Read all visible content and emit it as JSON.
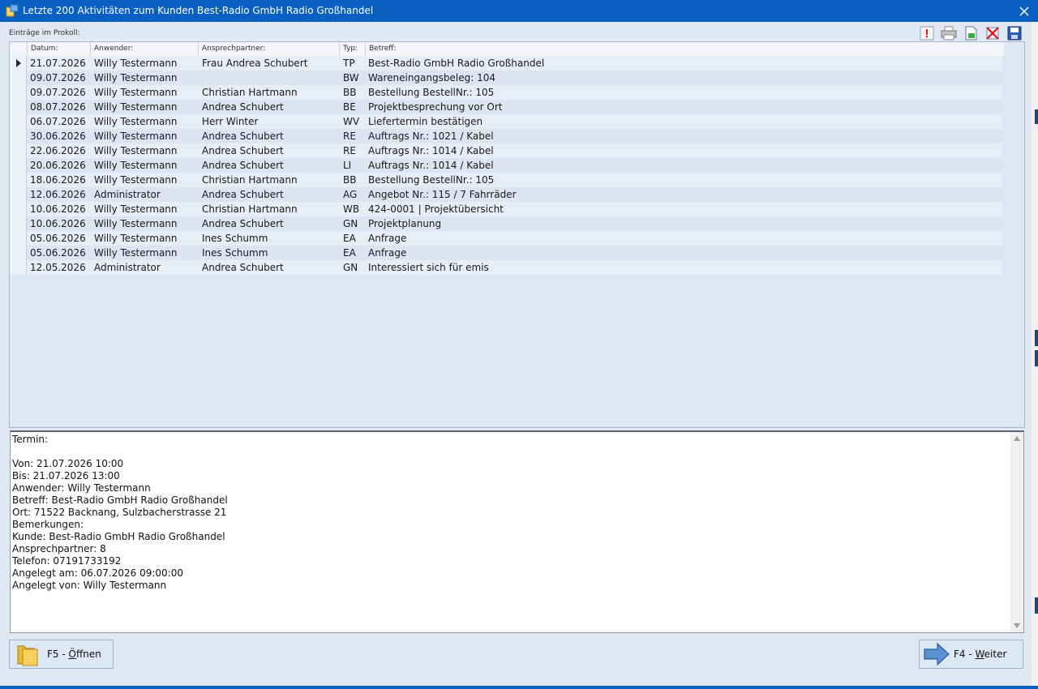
{
  "window": {
    "title": "Letzte 200 Aktivitäten zum Kunden Best-Radio GmbH Radio Großhandel"
  },
  "list_label": "Einträge im Prokoll:",
  "columns": {
    "datum": "Datum:",
    "anwender": "Anwender:",
    "ansprechpartner": "Ansprechpartner:",
    "typ": "Typ:",
    "betreff": "Betreff:"
  },
  "rows": [
    {
      "datum": "21.07.2026",
      "anwender": "Willy Testermann",
      "ansprechpartner": "Frau Andrea Schubert",
      "typ": "TP",
      "betreff": "Best-Radio GmbH Radio Großhandel"
    },
    {
      "datum": "09.07.2026",
      "anwender": "Willy Testermann",
      "ansprechpartner": "",
      "typ": "BW",
      "betreff": "Wareneingangsbeleg: 104"
    },
    {
      "datum": "09.07.2026",
      "anwender": "Willy Testermann",
      "ansprechpartner": "Christian Hartmann",
      "typ": "BB",
      "betreff": "Bestellung BestellNr.: 105"
    },
    {
      "datum": "08.07.2026",
      "anwender": "Willy Testermann",
      "ansprechpartner": "Andrea Schubert",
      "typ": "BE",
      "betreff": "Projektbesprechung vor Ort"
    },
    {
      "datum": "06.07.2026",
      "anwender": "Willy Testermann",
      "ansprechpartner": "Herr Winter",
      "typ": "WV",
      "betreff": "Liefertermin bestätigen"
    },
    {
      "datum": "30.06.2026",
      "anwender": "Willy Testermann",
      "ansprechpartner": "Andrea Schubert",
      "typ": "RE",
      "betreff": "Auftrags Nr.: 1021 / Kabel"
    },
    {
      "datum": "22.06.2026",
      "anwender": "Willy Testermann",
      "ansprechpartner": "Andrea Schubert",
      "typ": "RE",
      "betreff": "Auftrags Nr.: 1014 / Kabel"
    },
    {
      "datum": "20.06.2026",
      "anwender": "Willy Testermann",
      "ansprechpartner": "Andrea Schubert",
      "typ": "LI",
      "betreff": "Auftrags Nr.: 1014 / Kabel"
    },
    {
      "datum": "18.06.2026",
      "anwender": "Willy Testermann",
      "ansprechpartner": "Christian Hartmann",
      "typ": "BB",
      "betreff": "Bestellung BestellNr.: 105"
    },
    {
      "datum": "12.06.2026",
      "anwender": "Administrator",
      "ansprechpartner": "Andrea Schubert",
      "typ": "AG",
      "betreff": "Angebot Nr.: 115 / 7 Fahrräder"
    },
    {
      "datum": "10.06.2026",
      "anwender": "Willy Testermann",
      "ansprechpartner": "Christian Hartmann",
      "typ": "WB",
      "betreff": "424-0001 | Projektübersicht"
    },
    {
      "datum": "10.06.2026",
      "anwender": "Willy Testermann",
      "ansprechpartner": "Andrea Schubert",
      "typ": "GN",
      "betreff": "Projektplanung"
    },
    {
      "datum": "05.06.2026",
      "anwender": "Willy Testermann",
      "ansprechpartner": "Ines Schumm",
      "typ": "EA",
      "betreff": "Anfrage"
    },
    {
      "datum": "05.06.2026",
      "anwender": "Willy Testermann",
      "ansprechpartner": "Ines Schumm",
      "typ": "EA",
      "betreff": "Anfrage"
    },
    {
      "datum": "12.05.2026",
      "anwender": "Administrator",
      "ansprechpartner": "Andrea Schubert",
      "typ": "GN",
      "betreff": "Interessiert sich für emis"
    }
  ],
  "detail_text": "Termin:\n\nVon: 21.07.2026 10:00\nBis: 21.07.2026 13:00\nAnwender: Willy Testermann\nBetreff: Best-Radio GmbH Radio Großhandel\nOrt: 71522 Backnang, Sulzbacherstrasse 21\nBemerkungen:\nKunde: Best-Radio GmbH Radio Großhandel\nAnsprechpartner: 8\nTelefon: 07191733192\nAngelegt am: 06.07.2026 09:00:00\nAngelegt von: Willy Testermann",
  "buttons": {
    "open": {
      "prefix": "F5 - ",
      "mnemonic": "Ö",
      "rest": "ffnen"
    },
    "next": {
      "prefix": "F4 - ",
      "mnemonic": "W",
      "rest": "eiter"
    }
  },
  "icons": [
    "app-icon",
    "close-icon",
    "priority-icon",
    "print-icon",
    "export-icon",
    "delete-icon",
    "save-icon",
    "folder-icon",
    "arrow-right-icon"
  ]
}
